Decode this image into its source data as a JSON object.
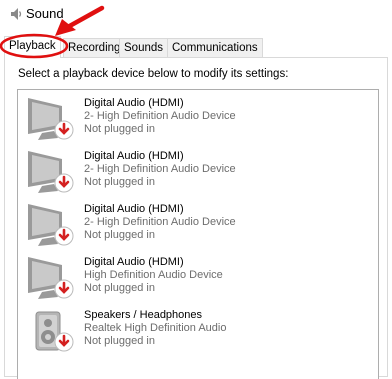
{
  "window": {
    "title": "Sound"
  },
  "tabs": [
    {
      "label": "Playback",
      "active": true
    },
    {
      "label": "Recording",
      "active": false
    },
    {
      "label": "Sounds",
      "active": false
    },
    {
      "label": "Communications",
      "active": false
    }
  ],
  "playback": {
    "instruction": "Select a playback device below to modify its settings:",
    "devices": [
      {
        "name": "Digital Audio (HDMI)",
        "description": "2- High Definition Audio Device",
        "status": "Not plugged in",
        "icon": "monitor-icon"
      },
      {
        "name": "Digital Audio (HDMI)",
        "description": "2- High Definition Audio Device",
        "status": "Not plugged in",
        "icon": "monitor-icon"
      },
      {
        "name": "Digital Audio (HDMI)",
        "description": "2- High Definition Audio Device",
        "status": "Not plugged in",
        "icon": "monitor-icon"
      },
      {
        "name": "Digital Audio (HDMI)",
        "description": "High Definition Audio Device",
        "status": "Not plugged in",
        "icon": "monitor-icon"
      },
      {
        "name": "Speakers / Headphones",
        "description": "Realtek High Definition Audio",
        "status": "Not plugged in",
        "icon": "speaker-icon"
      }
    ]
  },
  "colors": {
    "annotation_red": "#e01010",
    "status_arrow_red": "#d42020",
    "secondary_text": "#6d6d6d"
  }
}
